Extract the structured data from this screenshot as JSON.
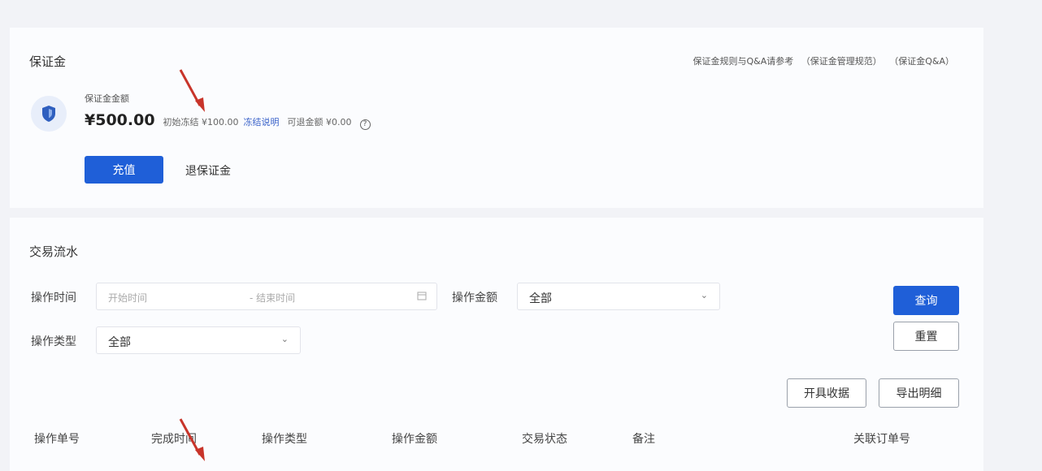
{
  "deposit": {
    "title": "保证金",
    "links": [
      "保证金规则与Q&A请参考",
      "（保证金管理规范）",
      "（保证金Q&A）"
    ],
    "balance_label": "保证金金额",
    "balance_amount": "¥500.00",
    "frozen_label": "初始冻结 ¥100.00",
    "frozen_link": "冻结说明",
    "withdrawable_label": "可退金额 ¥0.00",
    "info_icon": "?",
    "recharge_label": "充值",
    "withdraw_label": "退保证金"
  },
  "flow": {
    "title": "交易流水",
    "time_label": "操作时间",
    "start_placeholder": "开始时间",
    "end_placeholder": "- 结束时间",
    "calendar_icon": "calendar-icon",
    "amount_label": "操作金额",
    "amount_value": "全部",
    "type_label": "操作类型",
    "type_value": "全部",
    "query_label": "查询",
    "reset_label": "重置",
    "receipt_label": "开具收据",
    "export_label": "导出明细",
    "columns": [
      "操作单号",
      "完成时间",
      "操作类型",
      "操作金额",
      "交易状态",
      "备注",
      "关联订单号"
    ]
  },
  "colors": {
    "primary": "#1f5fd8",
    "arrow": "#c8342a"
  }
}
